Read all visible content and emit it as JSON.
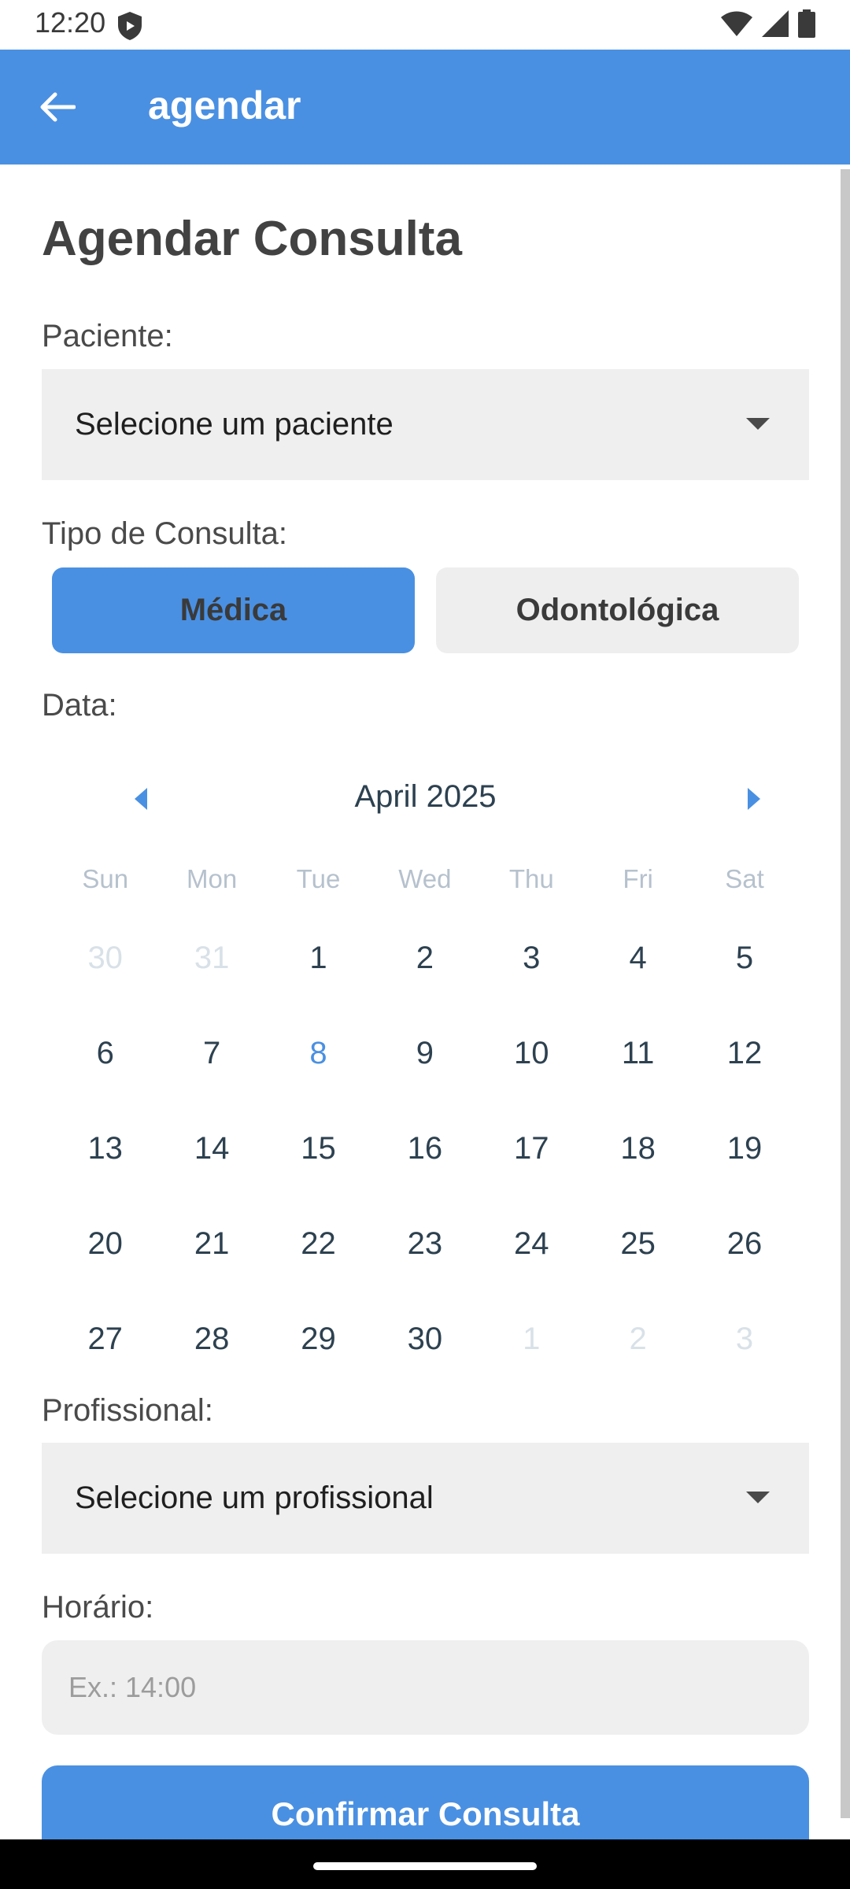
{
  "status_bar": {
    "time": "12:20"
  },
  "app_bar": {
    "title": "agendar"
  },
  "page": {
    "title": "Agendar Consulta"
  },
  "patient": {
    "label": "Paciente:",
    "selected": "Selecione um paciente"
  },
  "consult_type": {
    "label": "Tipo de Consulta:",
    "options": [
      "Médica",
      "Odontológica"
    ],
    "selected": "Médica"
  },
  "date": {
    "label": "Data:"
  },
  "calendar": {
    "month": "April 2025",
    "weekdays": [
      "Sun",
      "Mon",
      "Tue",
      "Wed",
      "Thu",
      "Fri",
      "Sat"
    ],
    "today": "8",
    "weeks": [
      [
        "30",
        "31",
        "1",
        "2",
        "3",
        "4",
        "5"
      ],
      [
        "6",
        "7",
        "8",
        "9",
        "10",
        "11",
        "12"
      ],
      [
        "13",
        "14",
        "15",
        "16",
        "17",
        "18",
        "19"
      ],
      [
        "20",
        "21",
        "22",
        "23",
        "24",
        "25",
        "26"
      ],
      [
        "27",
        "28",
        "29",
        "30",
        "1",
        "2",
        "3"
      ]
    ]
  },
  "professional": {
    "label": "Profissional:",
    "selected": "Selecione um profissional"
  },
  "time": {
    "label": "Horário:",
    "placeholder": "Ex.: 14:00",
    "value": ""
  },
  "confirm": {
    "label": "Confirmar Consulta"
  },
  "colors": {
    "primary": "#4a90e2",
    "field_bg": "#efefef",
    "text_dark": "#2d4150",
    "muted": "#d9e1e8"
  },
  "icons": {
    "back": "arrow-left-icon",
    "select": "caret-down-icon",
    "prev_month": "chevron-left-icon",
    "next_month": "chevron-right-icon"
  }
}
